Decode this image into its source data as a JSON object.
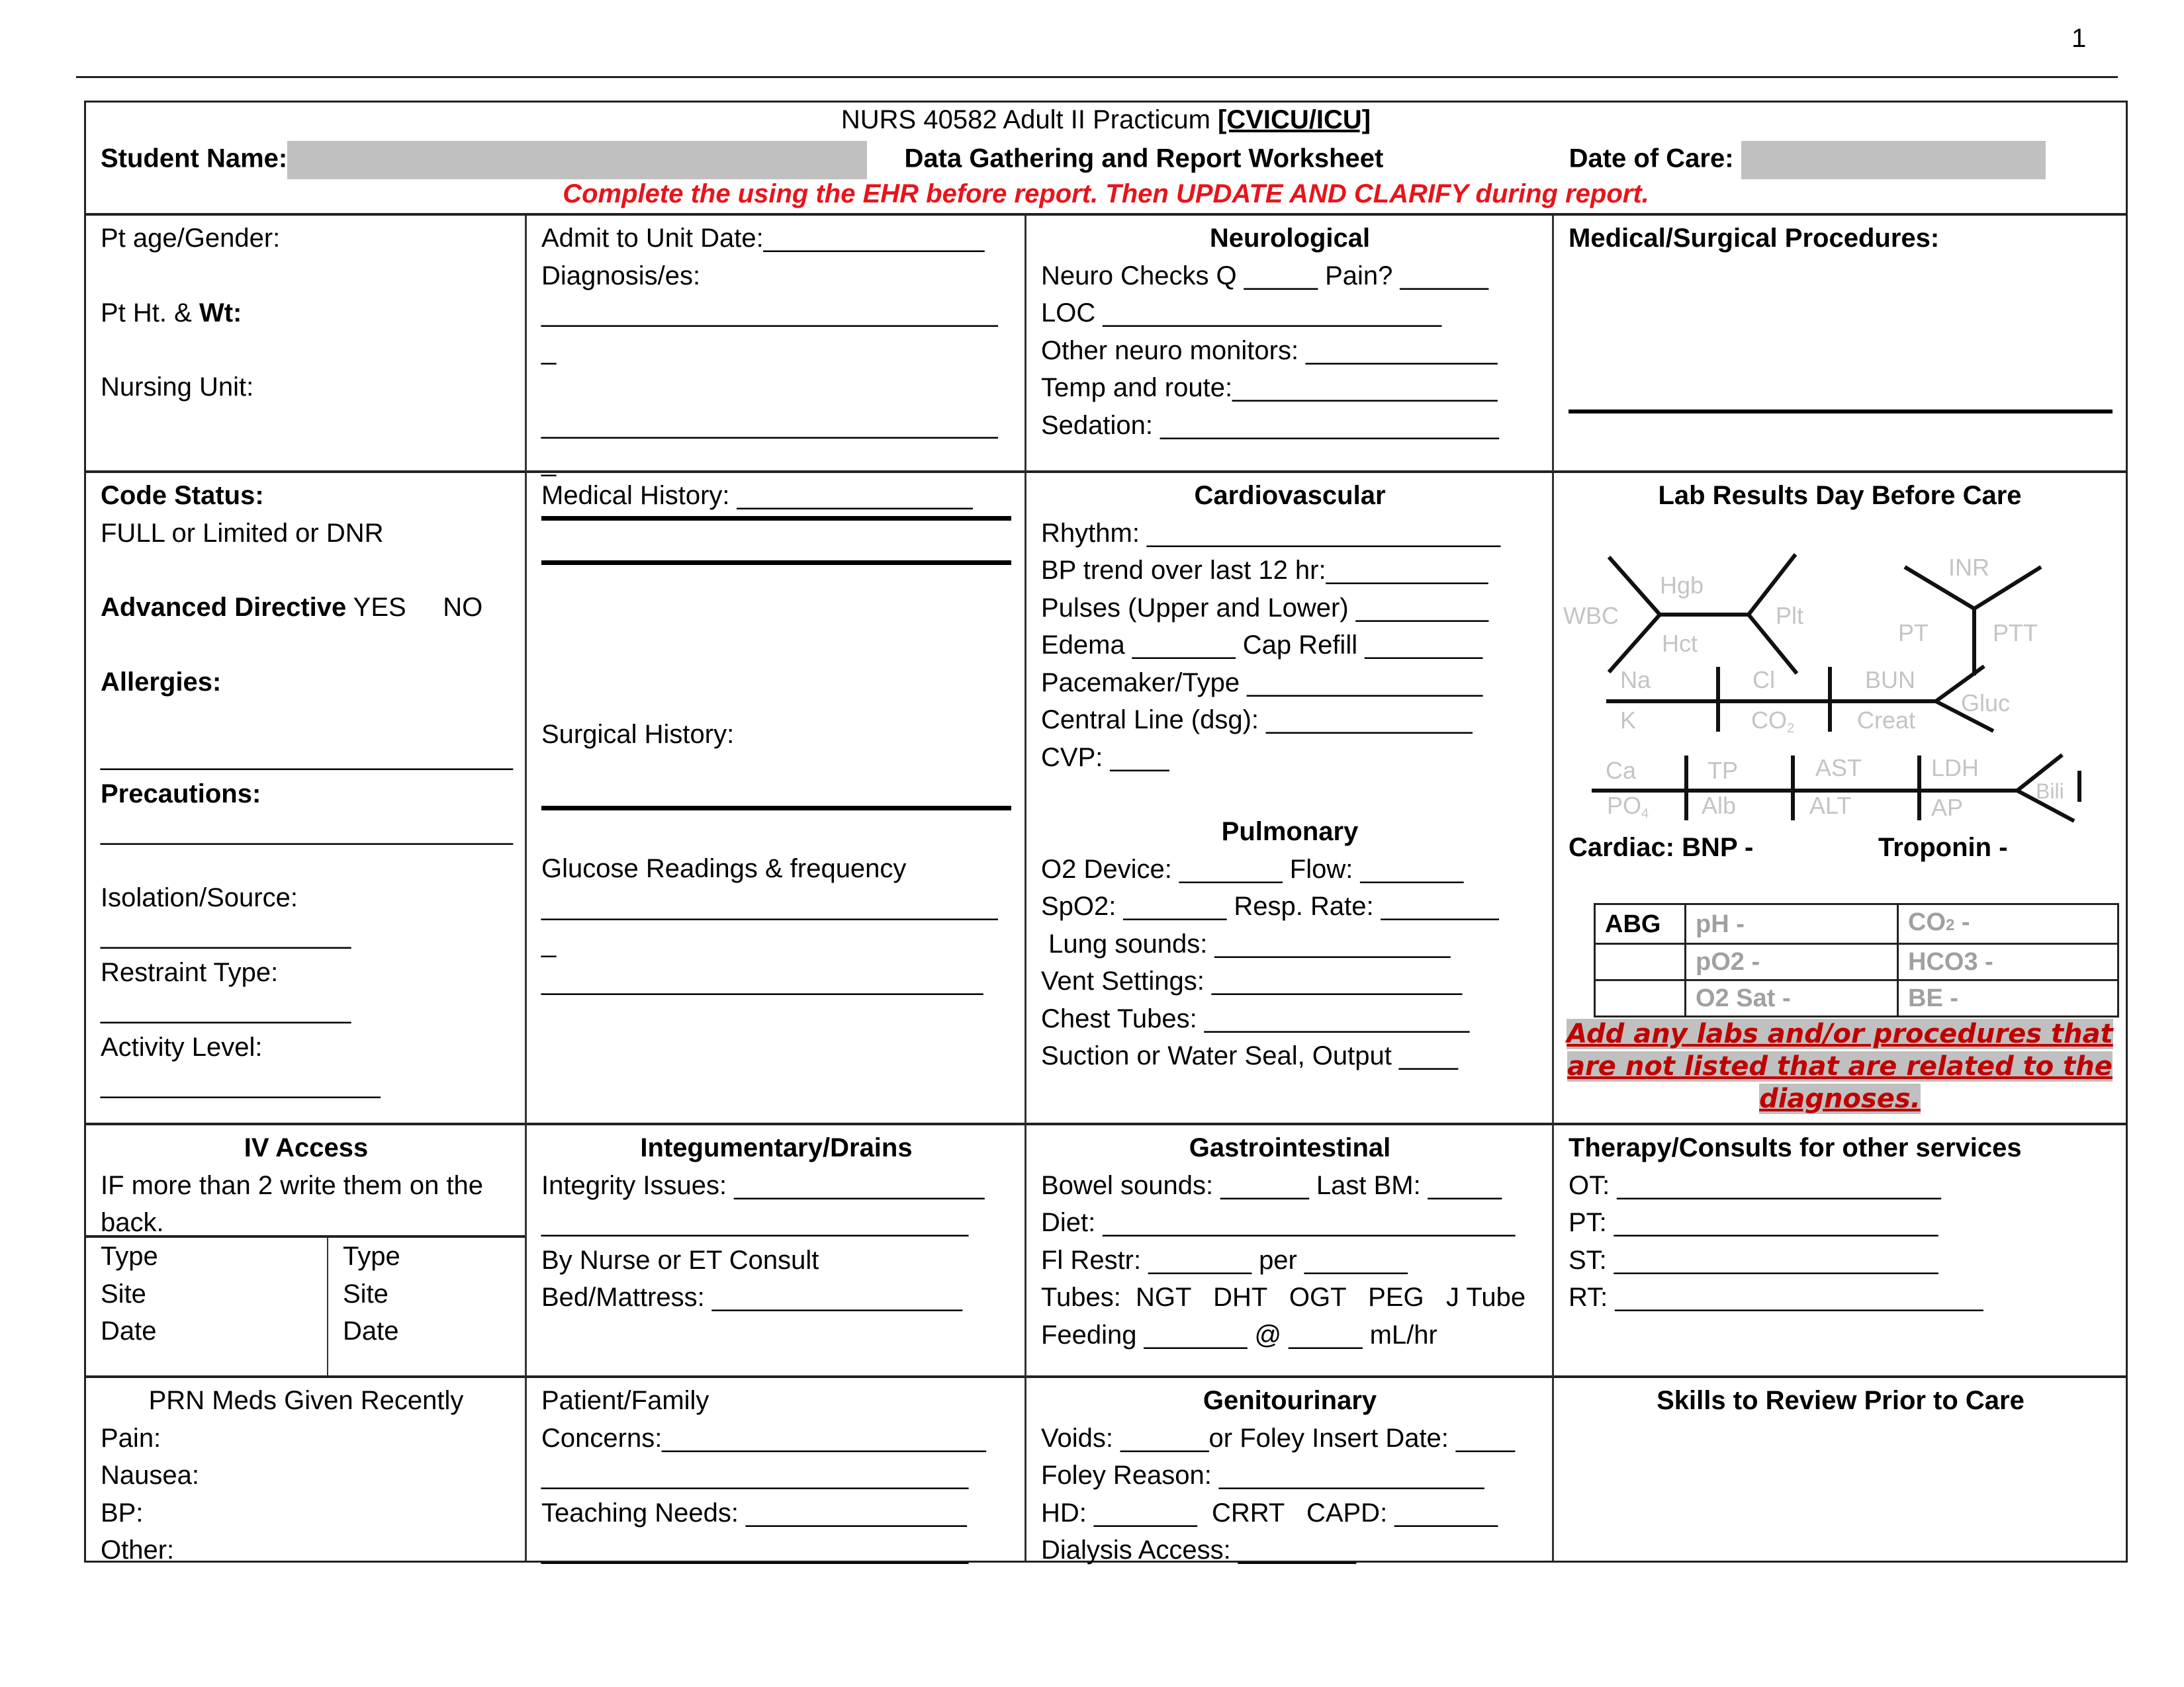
{
  "page_number": "1",
  "header": {
    "course": "NURS 40582 Adult II Practicum",
    "unit": "[CVICU/ICU]",
    "student_name_label": "Student Name:",
    "student_name_blank": "________________________________",
    "worksheet_title": "Data Gathering and Report Worksheet",
    "date_of_care_label": "Date of Care:",
    "date_of_care_blank": "_________________",
    "instruction": "Complete the using the EHR before report. Then UPDATE AND CLARIFY during report."
  },
  "row1": {
    "patient": {
      "age_gender": "Pt age/Gender:",
      "height_label": "Pt Ht. & ",
      "weight_label": "Wt:",
      "nursing_unit": "Nursing Unit:"
    },
    "admit": {
      "admit_date": "Admit to Unit Date:_______________",
      "diagnosis": "Diagnosis/es:",
      "blank1": "_______________________________",
      "blank1b": "_",
      "blank2": "_______________________________",
      "blank2b": "_"
    },
    "neuro": {
      "title": "Neurological",
      "lines": [
        "Neuro Checks Q _____    Pain? ______",
        "LOC _______________________",
        "Other neuro monitors: _____________",
        "Temp and route:__________________",
        "Sedation: _______________________"
      ]
    },
    "procedures": {
      "title": "Medical/Surgical Procedures:"
    }
  },
  "row2": {
    "status": {
      "code_status_label": "Code Status:",
      "code_status_options": "FULL or Limited or DNR",
      "advanced_directive_label": "Advanced Directive",
      "advanced_directive_options": " YES     NO",
      "allergies_label": "Allergies:",
      "allergies_blank": "____________________________",
      "precautions_label": "Precautions:",
      "precautions_blank": "____________________________",
      "isolation_label": "Isolation/Source:",
      "isolation_blank": "_________________",
      "restraint_label": "Restraint Type:",
      "restraint_blank": "_________________",
      "activity_label": "Activity Level:",
      "activity_blank": "___________________"
    },
    "history": {
      "medical_history": "Medical History:  ________________",
      "surgical_history": "Surgical History:",
      "glucose": "Glucose Readings & frequency",
      "glucose_blank1": "_______________________________",
      "glucose_blank1b": "_",
      "glucose_blank2": "______________________________"
    },
    "cardio": {
      "title": "Cardiovascular",
      "lines": [
        "Rhythm:  ________________________",
        "BP trend over last 12 hr:___________",
        "Pulses (Upper and Lower) _________",
        "Edema _______  Cap Refill ________",
        "Pacemaker/Type ________________",
        "Central Line (dsg):  ______________",
        "CVP: ____"
      ]
    },
    "pulmonary": {
      "title": "Pulmonary",
      "lines": [
        "O2 Device: _______  Flow:  _______",
        "SpO2: _______  Resp. Rate: ________",
        " Lung sounds: ________________",
        "Vent Settings: _________________",
        "Chest Tubes: __________________",
        "Suction or Water Seal, Output ____"
      ]
    },
    "labs": {
      "title": "Lab Results Day Before Care",
      "cbc": {
        "wbc": "WBC",
        "hgb": "Hgb",
        "hct": "Hct",
        "plt": "Plt"
      },
      "coag": {
        "inr": "INR",
        "pt": "PT",
        "ptt": "PTT"
      },
      "bmp": {
        "na": "Na",
        "k": "K",
        "cl": "Cl",
        "co2": "CO",
        "co2_sub": "2",
        "bun": "BUN",
        "creat": "Creat",
        "gluc": "Gluc"
      },
      "lft": {
        "ca": "Ca",
        "po4": "PO",
        "po4_sub": "4",
        "tp": "TP",
        "alb": "Alb",
        "ast": "AST",
        "alt": "ALT",
        "ldh": "LDH",
        "ap": "AP",
        "bili": "Bili"
      },
      "cardiac_label": "Cardiac: BNP -",
      "troponin_label": "Troponin -",
      "abg": {
        "header": "ABG",
        "rows": [
          [
            "pH -",
            "CO2 -"
          ],
          [
            "pO2 -",
            "HCO3 -"
          ],
          [
            "O2 Sat -",
            "BE -"
          ]
        ]
      },
      "notice": "Add any labs and/or procedures that are not listed that are related to the diagnoses."
    }
  },
  "row3": {
    "iv": {
      "title": "IV Access",
      "note": " IF more than 2 write them on the back.",
      "col1": [
        "Type",
        "Site",
        "Date"
      ],
      "col2": [
        "Type",
        "Site",
        "Date"
      ]
    },
    "integ": {
      "title": "Integumentary/Drains",
      "lines": [
        "Integrity Issues: _________________",
        "_____________________________",
        "By Nurse or ET Consult",
        "Bed/Mattress: _________________"
      ]
    },
    "gi": {
      "title": "Gastrointestinal",
      "lines": [
        "Bowel sounds: ______ Last BM: _____",
        "Diet: ____________________________",
        "Fl Restr: _______ per _______",
        "Tubes:  NGT   DHT   OGT   PEG   J Tube",
        "Feeding _______ @ _____ mL/hr"
      ]
    },
    "therapy": {
      "title": "Therapy/Consults for other services",
      "lines": [
        "OT: ______________________",
        "PT: ______________________",
        "ST: ______________________",
        "RT: _________________________"
      ]
    }
  },
  "row4": {
    "prn": {
      "title": "PRN Meds Given Recently",
      "lines": [
        "Pain:",
        "Nausea:",
        "BP:",
        "Other:"
      ]
    },
    "family": {
      "lines": [
        "Patient/Family",
        "Concerns:______________________",
        "_____________________________",
        "Teaching Needs: _______________",
        "_____________________________"
      ]
    },
    "gu": {
      "title": "Genitourinary",
      "lines": [
        "Voids: ______or Foley Insert Date: ____",
        "Foley Reason: __________________",
        "HD: _______  CRRT   CAPD: _______",
        "Dialysis Access: ________"
      ]
    },
    "skills": {
      "title": "Skills to Review Prior to Care"
    }
  },
  "colors": {
    "instruction_red": "#e8141b",
    "notice_red": "#c00000",
    "highlight_gray": "#c0c0c0",
    "lab_label_gray": "#c4c4c4"
  }
}
